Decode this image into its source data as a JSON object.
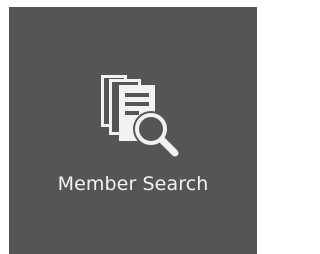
{
  "tile": {
    "label": "Member Search",
    "icon": "document-search-icon",
    "background": "#555555",
    "foreground": "#f2f2f2"
  }
}
